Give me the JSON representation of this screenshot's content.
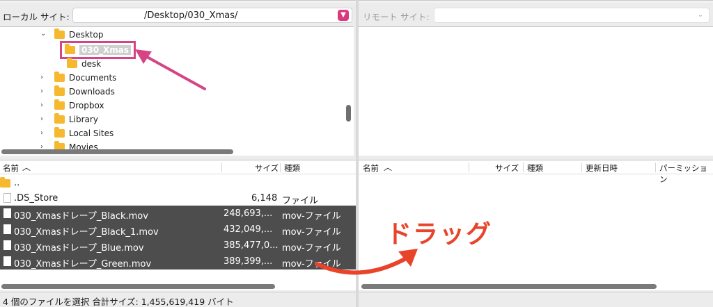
{
  "local": {
    "site_label": "ローカル サイト:",
    "path": "/Desktop/030_Xmas/",
    "tree": [
      {
        "label": "Desktop",
        "expanded": true,
        "level": 0
      },
      {
        "label": "030_Xmas",
        "selected": true,
        "level": 1
      },
      {
        "label": "desk",
        "level": 1
      },
      {
        "label": "Documents",
        "level": 0
      },
      {
        "label": "Downloads",
        "level": 0
      },
      {
        "label": "Dropbox",
        "level": 0
      },
      {
        "label": "Library",
        "level": 0
      },
      {
        "label": "Local Sites",
        "level": 0
      },
      {
        "label": "Movies",
        "level": 0
      }
    ],
    "columns": {
      "name": "名前",
      "size": "サイズ",
      "type": "種類"
    },
    "files": [
      {
        "name": "..",
        "size": "",
        "type": "",
        "selected": false
      },
      {
        "name": ".DS_Store",
        "size": "6,148",
        "type": "ファイル",
        "selected": false
      },
      {
        "name": "030_Xmasドレープ_Black.mov",
        "size": "248,693,...",
        "type": "mov-ファイル",
        "selected": true
      },
      {
        "name": "030_Xmasドレープ_Black_1.mov",
        "size": "432,049,...",
        "type": "mov-ファイル",
        "selected": true
      },
      {
        "name": "030_Xmasドレープ_Blue.mov",
        "size": "385,477,0...",
        "type": "mov-ファイル",
        "selected": true
      },
      {
        "name": "030_Xmasドレープ_Green.mov",
        "size": "389,399,...",
        "type": "mov-ファイル",
        "selected": true
      }
    ],
    "status": "4 個のファイルを選択 合計サイズ: 1,455,619,419 バイト"
  },
  "remote": {
    "site_label": "リモート サイト:",
    "columns": {
      "name": "名前",
      "size": "サイズ",
      "type": "種類",
      "modified": "更新日時",
      "permission": "パーミッション"
    }
  },
  "annotation": {
    "drag_label": "ドラッグ",
    "highlight_color": "#d54585",
    "arrow_color": "#e8442a"
  },
  "icons": {
    "folder": "folder-icon",
    "file": "file-icon",
    "chevron_down": "chevron-down-icon",
    "chevron_right": "chevron-right-icon",
    "sort_up": "sort-ascending-icon"
  }
}
